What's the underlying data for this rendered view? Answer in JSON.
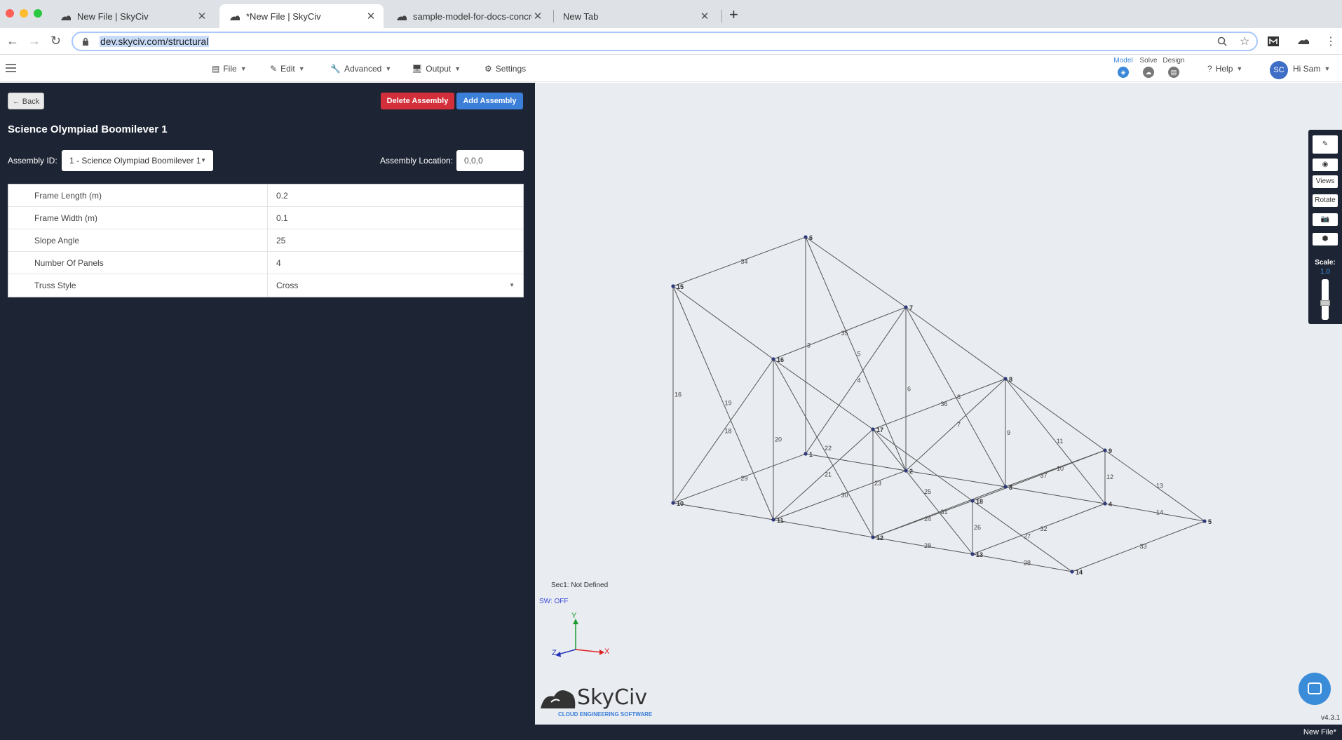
{
  "browser": {
    "tabs": [
      {
        "label": "New File | SkyCiv",
        "active": false
      },
      {
        "label": "*New File | SkyCiv",
        "active": true
      },
      {
        "label": "sample-model-for-docs-concret",
        "active": false
      },
      {
        "label": "New Tab",
        "active": false
      }
    ],
    "url": "dev.skyciv.com/structural"
  },
  "app": {
    "menu": {
      "file": "File",
      "edit": "Edit",
      "advanced": "Advanced",
      "output": "Output",
      "settings": "Settings"
    },
    "modes": {
      "model": "Model",
      "solve": "Solve",
      "design": "Design"
    },
    "help": "Help",
    "user_initials": "SC",
    "user_greeting": "Hi Sam"
  },
  "panel": {
    "back_label": "Back",
    "delete_label": "Delete Assembly",
    "add_label": "Add Assembly",
    "title": "Science Olympiad Boomilever 1",
    "assembly_id_label": "Assembly ID:",
    "assembly_id_value": "1 - Science Olympiad Boomilever 1",
    "assembly_location_label": "Assembly Location:",
    "assembly_location_value": "0,0,0",
    "properties": [
      {
        "key": "Frame Length (m)",
        "value": "0.2"
      },
      {
        "key": "Frame Width (m)",
        "value": "0.1"
      },
      {
        "key": "Slope Angle",
        "value": "25"
      },
      {
        "key": "Number Of Panels",
        "value": "4"
      },
      {
        "key": "Truss Style",
        "value": "Cross"
      }
    ]
  },
  "viewport": {
    "section_note": "Sec1: Not Defined",
    "sw_status": "SW: OFF",
    "tools": {
      "views": "Views",
      "rotate": "Rotate",
      "scale_label": "Scale:",
      "scale_value": "1.0"
    },
    "axes": {
      "x": "X",
      "y": "Y",
      "z": "Z"
    },
    "logo_word": "SkyCiv",
    "logo_sub": "CLOUD ENGINEERING SOFTWARE",
    "version": "v4.3.1",
    "status": "New File*",
    "colors": {
      "member": "#555555",
      "node": "#2e3b78",
      "panel": "#1d2434",
      "accent": "#3b7fd9"
    }
  }
}
